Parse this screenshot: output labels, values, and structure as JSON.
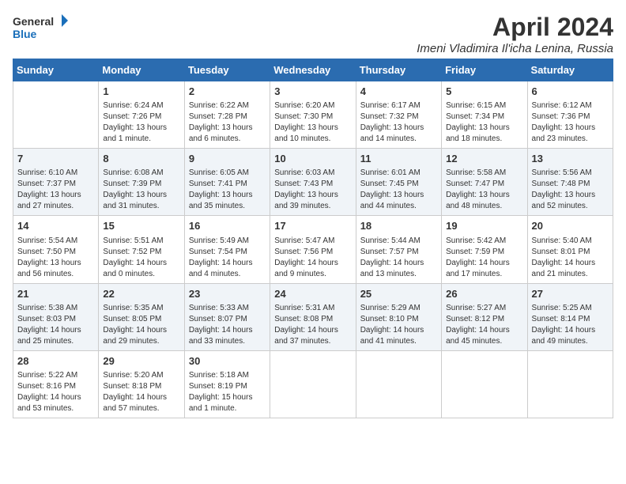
{
  "logo": {
    "line1": "General",
    "line2": "Blue"
  },
  "title": "April 2024",
  "location": "Imeni Vladimira Il'icha Lenina, Russia",
  "days_of_week": [
    "Sunday",
    "Monday",
    "Tuesday",
    "Wednesday",
    "Thursday",
    "Friday",
    "Saturday"
  ],
  "weeks": [
    [
      {
        "day": "",
        "info": ""
      },
      {
        "day": "1",
        "info": "Sunrise: 6:24 AM\nSunset: 7:26 PM\nDaylight: 13 hours\nand 1 minute."
      },
      {
        "day": "2",
        "info": "Sunrise: 6:22 AM\nSunset: 7:28 PM\nDaylight: 13 hours\nand 6 minutes."
      },
      {
        "day": "3",
        "info": "Sunrise: 6:20 AM\nSunset: 7:30 PM\nDaylight: 13 hours\nand 10 minutes."
      },
      {
        "day": "4",
        "info": "Sunrise: 6:17 AM\nSunset: 7:32 PM\nDaylight: 13 hours\nand 14 minutes."
      },
      {
        "day": "5",
        "info": "Sunrise: 6:15 AM\nSunset: 7:34 PM\nDaylight: 13 hours\nand 18 minutes."
      },
      {
        "day": "6",
        "info": "Sunrise: 6:12 AM\nSunset: 7:36 PM\nDaylight: 13 hours\nand 23 minutes."
      }
    ],
    [
      {
        "day": "7",
        "info": "Sunrise: 6:10 AM\nSunset: 7:37 PM\nDaylight: 13 hours\nand 27 minutes."
      },
      {
        "day": "8",
        "info": "Sunrise: 6:08 AM\nSunset: 7:39 PM\nDaylight: 13 hours\nand 31 minutes."
      },
      {
        "day": "9",
        "info": "Sunrise: 6:05 AM\nSunset: 7:41 PM\nDaylight: 13 hours\nand 35 minutes."
      },
      {
        "day": "10",
        "info": "Sunrise: 6:03 AM\nSunset: 7:43 PM\nDaylight: 13 hours\nand 39 minutes."
      },
      {
        "day": "11",
        "info": "Sunrise: 6:01 AM\nSunset: 7:45 PM\nDaylight: 13 hours\nand 44 minutes."
      },
      {
        "day": "12",
        "info": "Sunrise: 5:58 AM\nSunset: 7:47 PM\nDaylight: 13 hours\nand 48 minutes."
      },
      {
        "day": "13",
        "info": "Sunrise: 5:56 AM\nSunset: 7:48 PM\nDaylight: 13 hours\nand 52 minutes."
      }
    ],
    [
      {
        "day": "14",
        "info": "Sunrise: 5:54 AM\nSunset: 7:50 PM\nDaylight: 13 hours\nand 56 minutes."
      },
      {
        "day": "15",
        "info": "Sunrise: 5:51 AM\nSunset: 7:52 PM\nDaylight: 14 hours\nand 0 minutes."
      },
      {
        "day": "16",
        "info": "Sunrise: 5:49 AM\nSunset: 7:54 PM\nDaylight: 14 hours\nand 4 minutes."
      },
      {
        "day": "17",
        "info": "Sunrise: 5:47 AM\nSunset: 7:56 PM\nDaylight: 14 hours\nand 9 minutes."
      },
      {
        "day": "18",
        "info": "Sunrise: 5:44 AM\nSunset: 7:57 PM\nDaylight: 14 hours\nand 13 minutes."
      },
      {
        "day": "19",
        "info": "Sunrise: 5:42 AM\nSunset: 7:59 PM\nDaylight: 14 hours\nand 17 minutes."
      },
      {
        "day": "20",
        "info": "Sunrise: 5:40 AM\nSunset: 8:01 PM\nDaylight: 14 hours\nand 21 minutes."
      }
    ],
    [
      {
        "day": "21",
        "info": "Sunrise: 5:38 AM\nSunset: 8:03 PM\nDaylight: 14 hours\nand 25 minutes."
      },
      {
        "day": "22",
        "info": "Sunrise: 5:35 AM\nSunset: 8:05 PM\nDaylight: 14 hours\nand 29 minutes."
      },
      {
        "day": "23",
        "info": "Sunrise: 5:33 AM\nSunset: 8:07 PM\nDaylight: 14 hours\nand 33 minutes."
      },
      {
        "day": "24",
        "info": "Sunrise: 5:31 AM\nSunset: 8:08 PM\nDaylight: 14 hours\nand 37 minutes."
      },
      {
        "day": "25",
        "info": "Sunrise: 5:29 AM\nSunset: 8:10 PM\nDaylight: 14 hours\nand 41 minutes."
      },
      {
        "day": "26",
        "info": "Sunrise: 5:27 AM\nSunset: 8:12 PM\nDaylight: 14 hours\nand 45 minutes."
      },
      {
        "day": "27",
        "info": "Sunrise: 5:25 AM\nSunset: 8:14 PM\nDaylight: 14 hours\nand 49 minutes."
      }
    ],
    [
      {
        "day": "28",
        "info": "Sunrise: 5:22 AM\nSunset: 8:16 PM\nDaylight: 14 hours\nand 53 minutes."
      },
      {
        "day": "29",
        "info": "Sunrise: 5:20 AM\nSunset: 8:18 PM\nDaylight: 14 hours\nand 57 minutes."
      },
      {
        "day": "30",
        "info": "Sunrise: 5:18 AM\nSunset: 8:19 PM\nDaylight: 15 hours\nand 1 minute."
      },
      {
        "day": "",
        "info": ""
      },
      {
        "day": "",
        "info": ""
      },
      {
        "day": "",
        "info": ""
      },
      {
        "day": "",
        "info": ""
      }
    ]
  ]
}
